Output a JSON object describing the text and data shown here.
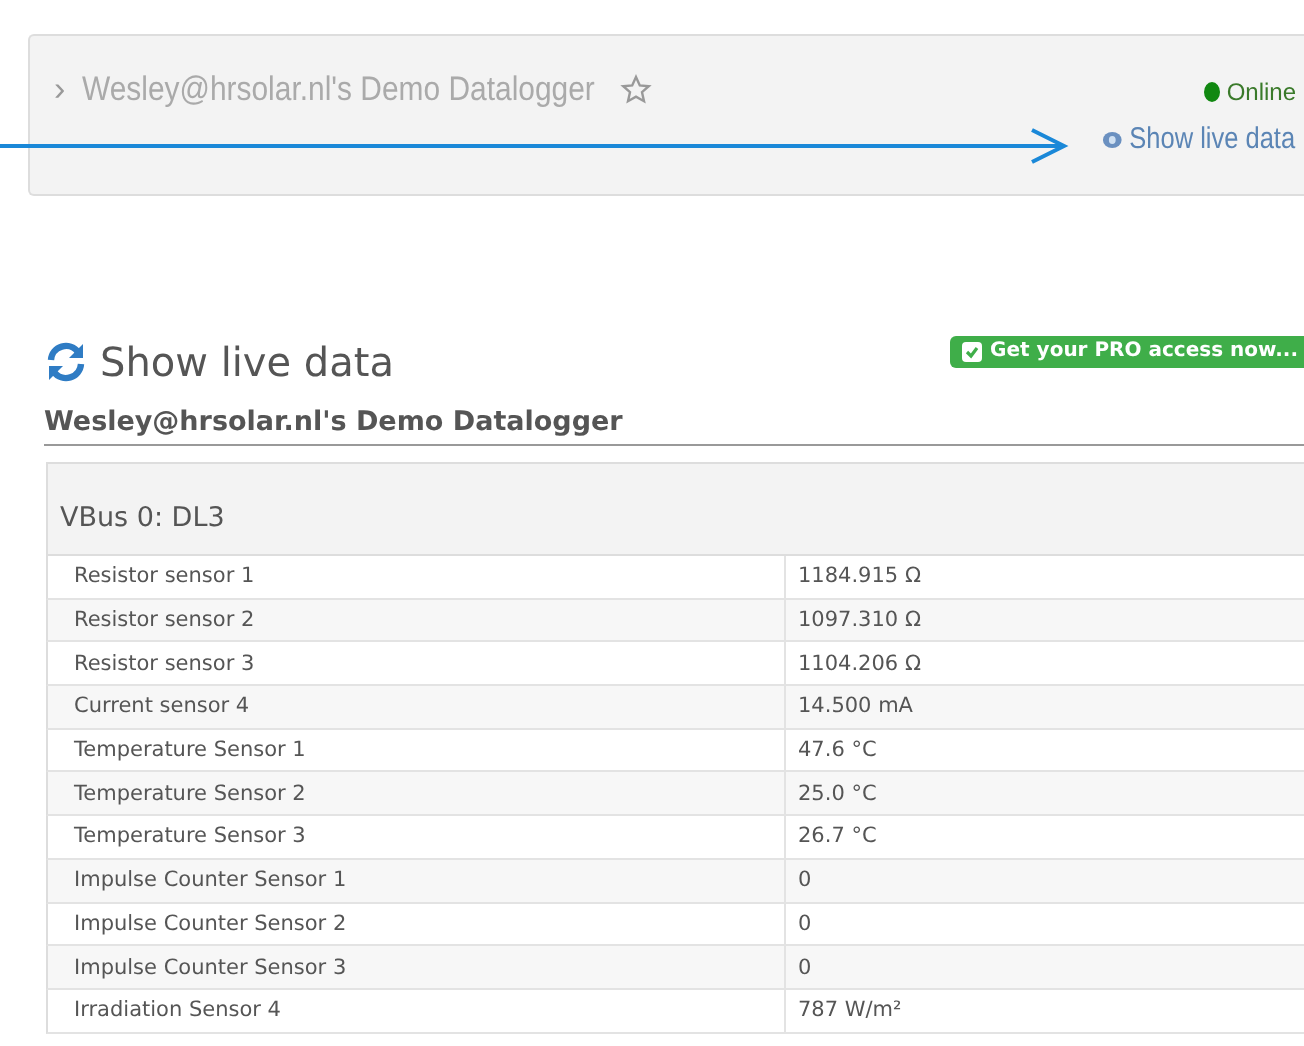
{
  "logger_card": {
    "expand_icon": "›",
    "title": "Wesley@hrsolar.nl's Demo Datalogger",
    "starred": false,
    "status": {
      "label": "Online",
      "color": "#118811"
    },
    "link": "Show live data"
  },
  "live_header": {
    "title": "Show live data",
    "pro_button": "Get your PRO access now..."
  },
  "datalogger_title": "Wesley@hrsolar.nl's Demo Datalogger",
  "table": {
    "heading": "VBus 0: DL3",
    "rows": [
      {
        "name": "Resistor sensor 1",
        "value": "1184.915 Ω"
      },
      {
        "name": "Resistor sensor 2",
        "value": "1097.310 Ω"
      },
      {
        "name": "Resistor sensor 3",
        "value": "1104.206 Ω"
      },
      {
        "name": "Current sensor 4",
        "value": "14.500 mA"
      },
      {
        "name": "Temperature Sensor 1",
        "value": "47.6 °C"
      },
      {
        "name": "Temperature Sensor 2",
        "value": "25.0 °C"
      },
      {
        "name": "Temperature Sensor 3",
        "value": "26.7 °C"
      },
      {
        "name": "Impulse Counter Sensor 1",
        "value": "0"
      },
      {
        "name": "Impulse Counter Sensor 2",
        "value": "0"
      },
      {
        "name": "Impulse Counter Sensor 3",
        "value": "0"
      },
      {
        "name": "Irradiation Sensor 4",
        "value": "787 W/m²"
      }
    ]
  }
}
